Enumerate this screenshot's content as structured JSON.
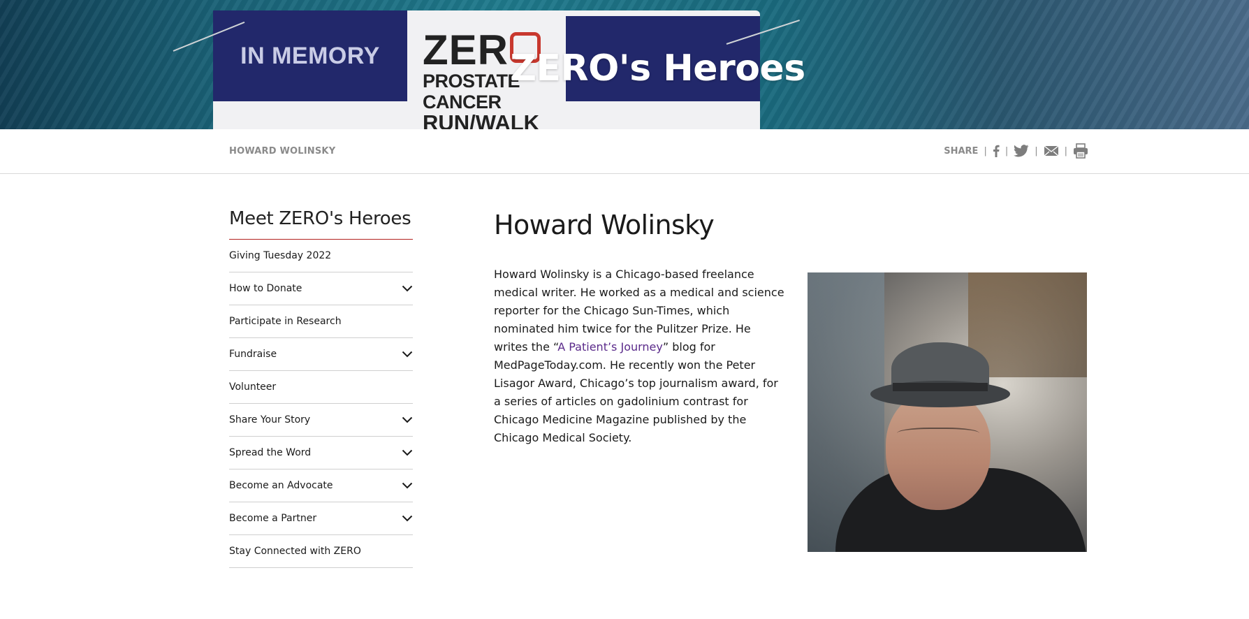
{
  "hero": {
    "title": "ZERO's Heroes",
    "bib_left_text": "IN MEMORY",
    "bib_zero": "ZER",
    "bib_line2": "PROSTATE CANCER",
    "bib_line3": "RUN/WALK"
  },
  "breadcrumb": {
    "current": "HOWARD WOLINSKY"
  },
  "share": {
    "label": "SHARE",
    "separator": "|",
    "icons": [
      "facebook-icon",
      "twitter-icon",
      "email-icon",
      "print-icon"
    ]
  },
  "sidebar": {
    "heading": "Meet ZERO's Heroes",
    "accent_color": "#b3211f",
    "items": [
      {
        "label": "Giving Tuesday 2022",
        "expandable": false
      },
      {
        "label": "How to Donate",
        "expandable": true
      },
      {
        "label": "Participate in Research",
        "expandable": false
      },
      {
        "label": "Fundraise",
        "expandable": true
      },
      {
        "label": "Volunteer",
        "expandable": false
      },
      {
        "label": "Share Your Story",
        "expandable": true
      },
      {
        "label": "Spread the Word",
        "expandable": true
      },
      {
        "label": "Become an Advocate",
        "expandable": true
      },
      {
        "label": "Become a Partner",
        "expandable": true
      },
      {
        "label": "Stay Connected with ZERO",
        "expandable": false
      }
    ]
  },
  "main": {
    "title": "Howard Wolinsky",
    "bio_before_link": "Howard Wolinsky is a Chicago-based freelance medical writer. He worked as a medical and science reporter for the Chicago Sun-Times, which nominated him twice for the Pulitzer Prize. He writes the “",
    "bio_link": "A Patient’s Journey",
    "bio_after_link": "” blog for MedPageToday.com. He recently won the Peter Lisagor Award, Chicago’s top journalism award, for a series of articles on gadolinium contrast for Chicago Medicine Magazine published by the Chicago Medical Society.",
    "link_color": "#5a2a8a"
  }
}
